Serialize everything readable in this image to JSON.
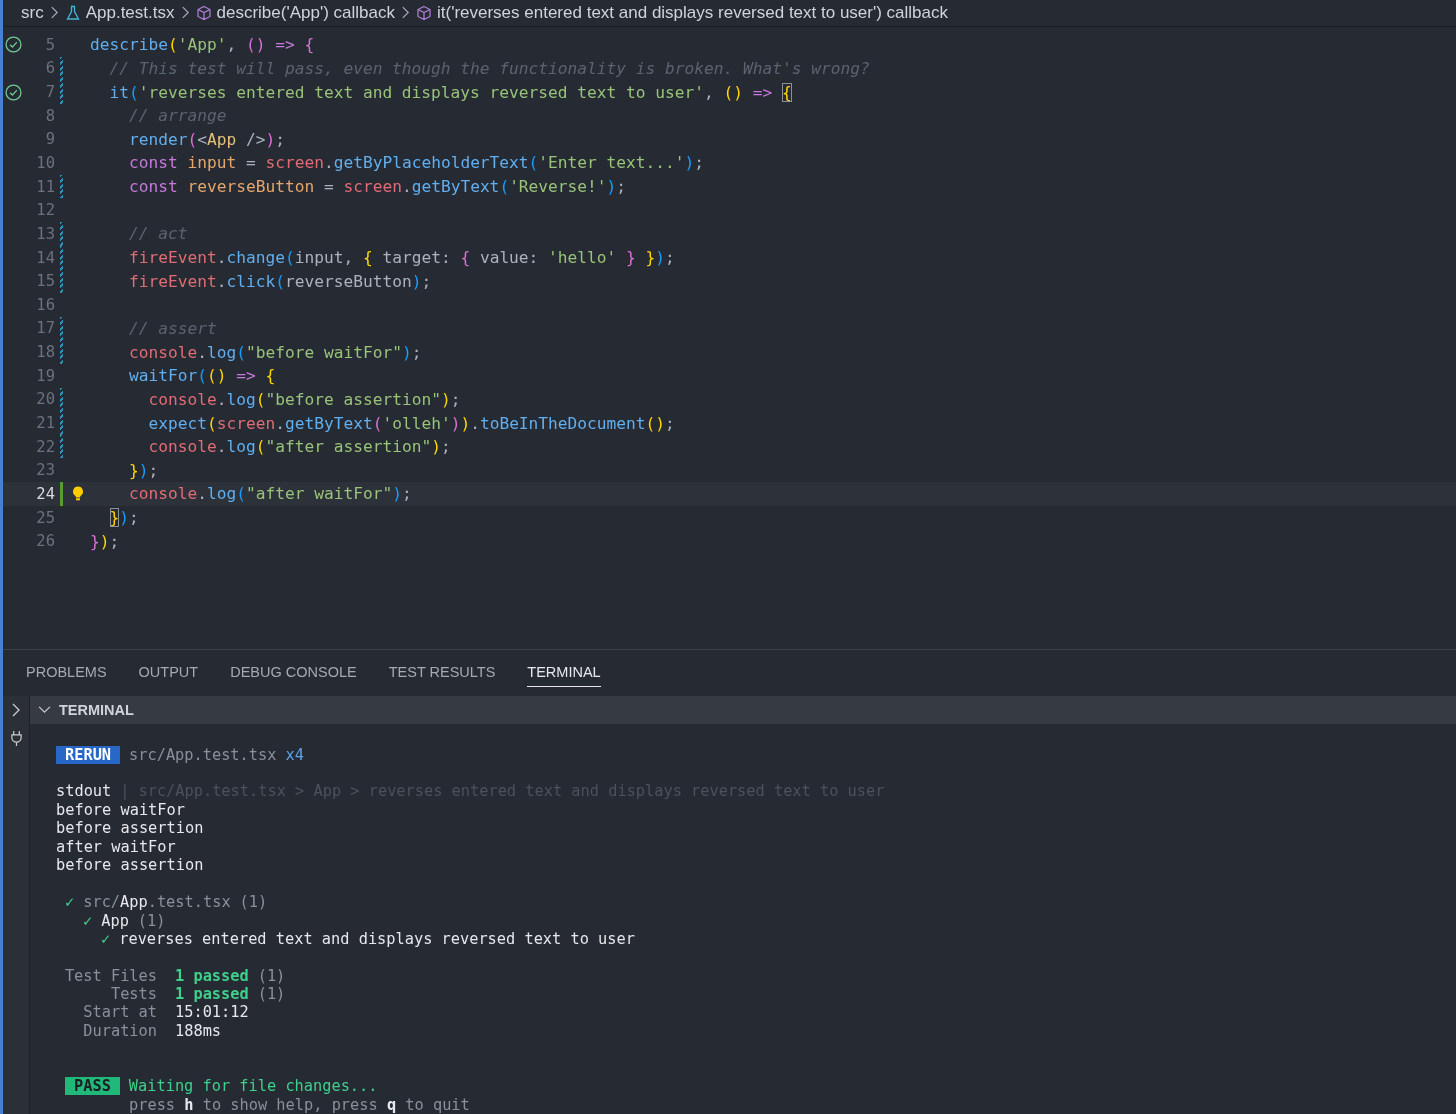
{
  "breadcrumb": [
    {
      "label": "src",
      "kind": "folder"
    },
    {
      "label": "App.test.tsx",
      "kind": "test-file"
    },
    {
      "label": "describe('App') callback",
      "kind": "symbol"
    },
    {
      "label": "it('reverses entered text and displays reversed text to user') callback",
      "kind": "symbol"
    }
  ],
  "code_lines": [
    {
      "number": "5",
      "test_passed": true,
      "tokens": [
        {
          "text": "describe",
          "kind": "fn"
        },
        {
          "text": "(",
          "kind": "b1"
        },
        {
          "text": "'App'",
          "kind": "str"
        },
        {
          "text": ", ",
          "kind": "plain"
        },
        {
          "text": "()",
          "kind": "b2"
        },
        {
          "text": " => ",
          "kind": "op"
        },
        {
          "text": "{",
          "kind": "b2"
        }
      ]
    },
    {
      "number": "6",
      "modified": true,
      "tokens": [
        {
          "text": "  // This test will pass, even though the functionality is broken. What's wrong?",
          "kind": "comment"
        }
      ]
    },
    {
      "number": "7",
      "test_passed": true,
      "modified": true,
      "tokens": [
        {
          "text": "  it",
          "kind": "fn"
        },
        {
          "text": "(",
          "kind": "b3"
        },
        {
          "text": "'reverses entered text and displays reversed text to user'",
          "kind": "str"
        },
        {
          "text": ", ",
          "kind": "plain"
        },
        {
          "text": "()",
          "kind": "b1"
        },
        {
          "text": " => ",
          "kind": "op"
        },
        {
          "text": "{",
          "kind": "match"
        }
      ]
    },
    {
      "number": "8",
      "tokens": [
        {
          "text": "    // arrange",
          "kind": "comment"
        }
      ]
    },
    {
      "number": "9",
      "tokens": [
        {
          "text": "    render",
          "kind": "fn"
        },
        {
          "text": "(",
          "kind": "b2"
        },
        {
          "text": "<",
          "kind": "plain"
        },
        {
          "text": "App",
          "kind": "cls"
        },
        {
          "text": " />",
          "kind": "plain"
        },
        {
          "text": ")",
          "kind": "b2"
        },
        {
          "text": ";",
          "kind": "plain"
        }
      ]
    },
    {
      "number": "10",
      "tokens": [
        {
          "text": "    const ",
          "kind": "kw"
        },
        {
          "text": "input",
          "kind": "var"
        },
        {
          "text": " = ",
          "kind": "plain"
        },
        {
          "text": "screen",
          "kind": "obj"
        },
        {
          "text": ".",
          "kind": "plain"
        },
        {
          "text": "getByPlaceholderText",
          "kind": "fn"
        },
        {
          "text": "(",
          "kind": "b3"
        },
        {
          "text": "'Enter text...'",
          "kind": "str"
        },
        {
          "text": ")",
          "kind": "b3"
        },
        {
          "text": ";",
          "kind": "plain"
        }
      ]
    },
    {
      "number": "11",
      "modified": true,
      "tokens": [
        {
          "text": "    const ",
          "kind": "kw"
        },
        {
          "text": "reverseButton",
          "kind": "var"
        },
        {
          "text": " = ",
          "kind": "plain"
        },
        {
          "text": "screen",
          "kind": "obj"
        },
        {
          "text": ".",
          "kind": "plain"
        },
        {
          "text": "getByText",
          "kind": "fn"
        },
        {
          "text": "(",
          "kind": "b3"
        },
        {
          "text": "'Reverse!'",
          "kind": "str"
        },
        {
          "text": ")",
          "kind": "b3"
        },
        {
          "text": ";",
          "kind": "plain"
        }
      ]
    },
    {
      "number": "12"
    },
    {
      "number": "13",
      "modified": true,
      "tokens": [
        {
          "text": "    // act",
          "kind": "comment"
        }
      ]
    },
    {
      "number": "14",
      "modified": true,
      "tokens": [
        {
          "text": "    fireEvent",
          "kind": "obj"
        },
        {
          "text": ".",
          "kind": "plain"
        },
        {
          "text": "change",
          "kind": "fn"
        },
        {
          "text": "(",
          "kind": "b3"
        },
        {
          "text": "input, ",
          "kind": "plain"
        },
        {
          "text": "{",
          "kind": "b1"
        },
        {
          "text": " target: ",
          "kind": "plain"
        },
        {
          "text": "{",
          "kind": "b2"
        },
        {
          "text": " value: ",
          "kind": "plain"
        },
        {
          "text": "'hello'",
          "kind": "str"
        },
        {
          "text": " }",
          "kind": "b2"
        },
        {
          "text": " }",
          "kind": "b1"
        },
        {
          "text": ")",
          "kind": "b3"
        },
        {
          "text": ";",
          "kind": "plain"
        }
      ]
    },
    {
      "number": "15",
      "modified": true,
      "tokens": [
        {
          "text": "    fireEvent",
          "kind": "obj"
        },
        {
          "text": ".",
          "kind": "plain"
        },
        {
          "text": "click",
          "kind": "fn"
        },
        {
          "text": "(",
          "kind": "b3"
        },
        {
          "text": "reverseButton",
          "kind": "plain"
        },
        {
          "text": ")",
          "kind": "b3"
        },
        {
          "text": ";",
          "kind": "plain"
        }
      ]
    },
    {
      "number": "16"
    },
    {
      "number": "17",
      "modified": true,
      "tokens": [
        {
          "text": "    // assert",
          "kind": "comment"
        }
      ]
    },
    {
      "number": "18",
      "modified": true,
      "tokens": [
        {
          "text": "    console",
          "kind": "obj"
        },
        {
          "text": ".",
          "kind": "plain"
        },
        {
          "text": "log",
          "kind": "fn"
        },
        {
          "text": "(",
          "kind": "b3"
        },
        {
          "text": "\"before waitFor\"",
          "kind": "str"
        },
        {
          "text": ")",
          "kind": "b3"
        },
        {
          "text": ";",
          "kind": "plain"
        }
      ]
    },
    {
      "number": "19",
      "tokens": [
        {
          "text": "    waitFor",
          "kind": "fn"
        },
        {
          "text": "(",
          "kind": "b3"
        },
        {
          "text": "()",
          "kind": "b1"
        },
        {
          "text": " => ",
          "kind": "op"
        },
        {
          "text": "{",
          "kind": "b1"
        }
      ]
    },
    {
      "number": "20",
      "modified": true,
      "tokens": [
        {
          "text": "      console",
          "kind": "obj"
        },
        {
          "text": ".",
          "kind": "plain"
        },
        {
          "text": "log",
          "kind": "fn"
        },
        {
          "text": "(",
          "kind": "b1"
        },
        {
          "text": "\"before assertion\"",
          "kind": "str"
        },
        {
          "text": ")",
          "kind": "b1"
        },
        {
          "text": ";",
          "kind": "plain"
        }
      ]
    },
    {
      "number": "21",
      "modified": true,
      "tokens": [
        {
          "text": "      expect",
          "kind": "fn"
        },
        {
          "text": "(",
          "kind": "b1"
        },
        {
          "text": "screen",
          "kind": "obj"
        },
        {
          "text": ".",
          "kind": "plain"
        },
        {
          "text": "getByText",
          "kind": "fn"
        },
        {
          "text": "(",
          "kind": "b2"
        },
        {
          "text": "'olleh'",
          "kind": "str"
        },
        {
          "text": ")",
          "kind": "b2"
        },
        {
          "text": ")",
          "kind": "b1"
        },
        {
          "text": ".",
          "kind": "plain"
        },
        {
          "text": "toBeInTheDocument",
          "kind": "fn"
        },
        {
          "text": "()",
          "kind": "b1"
        },
        {
          "text": ";",
          "kind": "plain"
        }
      ]
    },
    {
      "number": "22",
      "modified": true,
      "tokens": [
        {
          "text": "      console",
          "kind": "obj"
        },
        {
          "text": ".",
          "kind": "plain"
        },
        {
          "text": "log",
          "kind": "fn"
        },
        {
          "text": "(",
          "kind": "b1"
        },
        {
          "text": "\"after assertion\"",
          "kind": "str"
        },
        {
          "text": ")",
          "kind": "b1"
        },
        {
          "text": ";",
          "kind": "plain"
        }
      ]
    },
    {
      "number": "23",
      "tokens": [
        {
          "text": "    }",
          "kind": "b1"
        },
        {
          "text": ")",
          "kind": "b3"
        },
        {
          "text": ";",
          "kind": "plain"
        }
      ]
    },
    {
      "number": "24",
      "added": true,
      "current": true,
      "lightbulb": true,
      "tokens": [
        {
          "text": "    console",
          "kind": "obj"
        },
        {
          "text": ".",
          "kind": "plain"
        },
        {
          "text": "log",
          "kind": "fn"
        },
        {
          "text": "(",
          "kind": "b3"
        },
        {
          "text": "\"after waitFor\"",
          "kind": "str"
        },
        {
          "text": ")",
          "kind": "b3"
        },
        {
          "text": ";",
          "kind": "plain"
        }
      ]
    },
    {
      "number": "25",
      "tokens": [
        {
          "text": "  }",
          "kind": "match"
        },
        {
          "text": ")",
          "kind": "b3"
        },
        {
          "text": ";",
          "kind": "plain"
        }
      ]
    },
    {
      "number": "26",
      "tokens": [
        {
          "text": "}",
          "kind": "b2"
        },
        {
          "text": ")",
          "kind": "b1"
        },
        {
          "text": ";",
          "kind": "plain"
        }
      ]
    }
  ],
  "panel_tabs": [
    {
      "label": "PROBLEMS",
      "selected": false
    },
    {
      "label": "OUTPUT",
      "selected": false
    },
    {
      "label": "DEBUG CONSOLE",
      "selected": false
    },
    {
      "label": "TEST RESULTS",
      "selected": false
    },
    {
      "label": "TERMINAL",
      "selected": true
    }
  ],
  "terminal": {
    "title": "TERMINAL",
    "rerun": {
      "badge": "RERUN",
      "file": "src/App.test.tsx",
      "count": "x4"
    },
    "stdout": {
      "label": "stdout",
      "separator": "|",
      "path": "src/App.test.tsx > App > reverses entered text and displays reversed text to user",
      "lines": [
        "before waitFor",
        "before assertion",
        "after waitFor",
        "before assertion"
      ]
    },
    "results": [
      {
        "check": "✓",
        "name": "src/**App**.test.tsx",
        "count": "(1)",
        "children": [
          {
            "check": "✓",
            "name": "App",
            "count": "(1)",
            "children": [
              {
                "check": "✓",
                "name": "reverses entered text and displays reversed text to user"
              }
            ]
          }
        ]
      }
    ],
    "summary": [
      {
        "label": "Test Files",
        "value": "1 passed",
        "extra": "(1)",
        "kind": "pass"
      },
      {
        "label": "Tests",
        "value": "1 passed",
        "extra": "(1)",
        "kind": "pass"
      },
      {
        "label": "Start at",
        "value": "15:01:12",
        "kind": "plain"
      },
      {
        "label": "Duration",
        "value": "188ms",
        "kind": "plain"
      }
    ],
    "status": {
      "badge": "PASS",
      "message": "Waiting for file changes...",
      "help": "press **h** to show help, press **q** to quit"
    }
  }
}
